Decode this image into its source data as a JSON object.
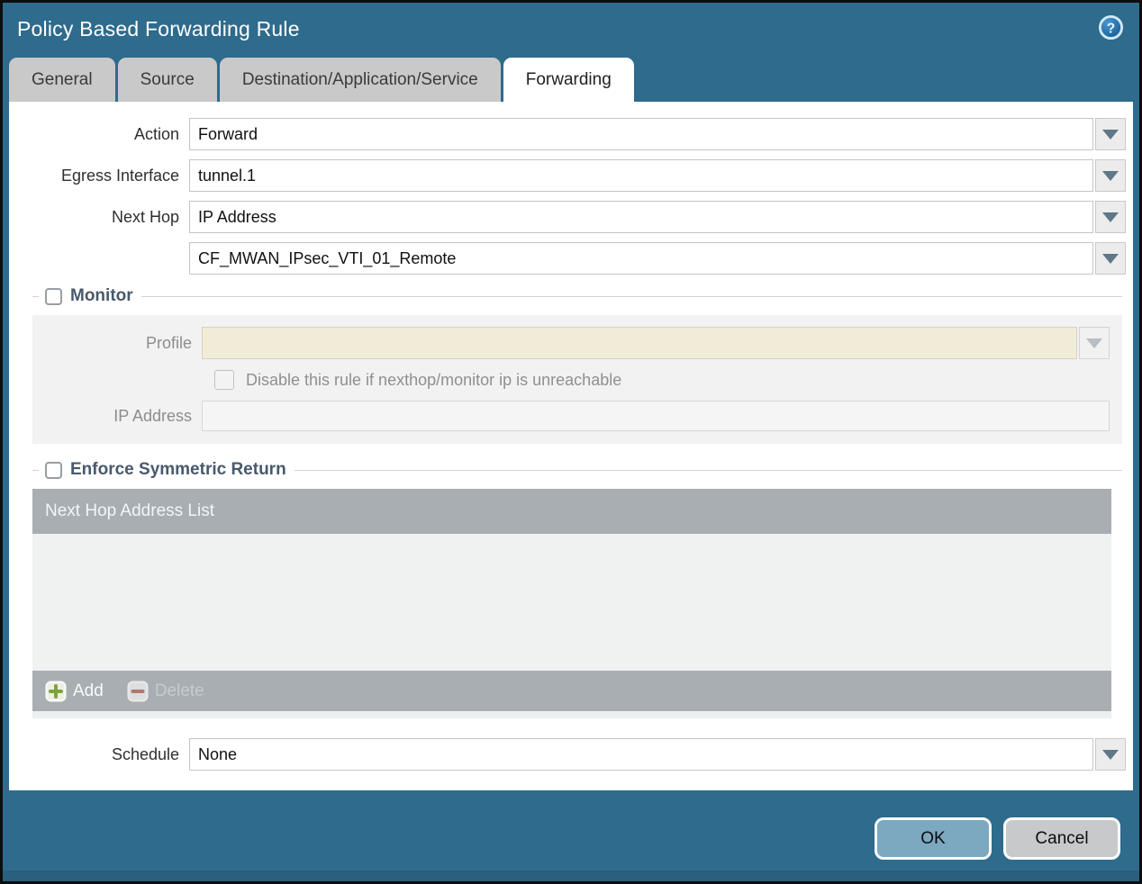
{
  "dialog": {
    "title": "Policy Based Forwarding Rule",
    "help_glyph": "?"
  },
  "tabs": [
    {
      "label": "General",
      "active": false
    },
    {
      "label": "Source",
      "active": false
    },
    {
      "label": "Destination/Application/Service",
      "active": false
    },
    {
      "label": "Forwarding",
      "active": true
    }
  ],
  "form": {
    "action": {
      "label": "Action",
      "value": "Forward"
    },
    "egress_interface": {
      "label": "Egress Interface",
      "value": "tunnel.1"
    },
    "next_hop": {
      "label": "Next Hop",
      "value": "IP Address"
    },
    "next_hop_address": {
      "value": "CF_MWAN_IPsec_VTI_01_Remote"
    },
    "schedule": {
      "label": "Schedule",
      "value": "None"
    }
  },
  "monitor": {
    "legend": "Monitor",
    "checked": false,
    "profile": {
      "label": "Profile",
      "value": ""
    },
    "disable_rule_label": "Disable this rule if nexthop/monitor ip is unreachable",
    "ip_address": {
      "label": "IP Address",
      "value": ""
    }
  },
  "enforce_symmetric_return": {
    "legend": "Enforce Symmetric Return",
    "checked": false,
    "table_header": "Next Hop Address List",
    "rows": [],
    "add_label": "Add",
    "delete_label": "Delete"
  },
  "footer": {
    "ok_label": "OK",
    "cancel_label": "Cancel"
  },
  "colors": {
    "titlebar_teal": "#2e6b8c",
    "ok_button": "#7ca8c0",
    "cancel_button": "#c7c9cb",
    "profile_field": "#f0ecd8",
    "table_gray": "#a9aeb3",
    "add_plus_green": "#7fa33c",
    "delete_minus_red": "#a2564a"
  }
}
